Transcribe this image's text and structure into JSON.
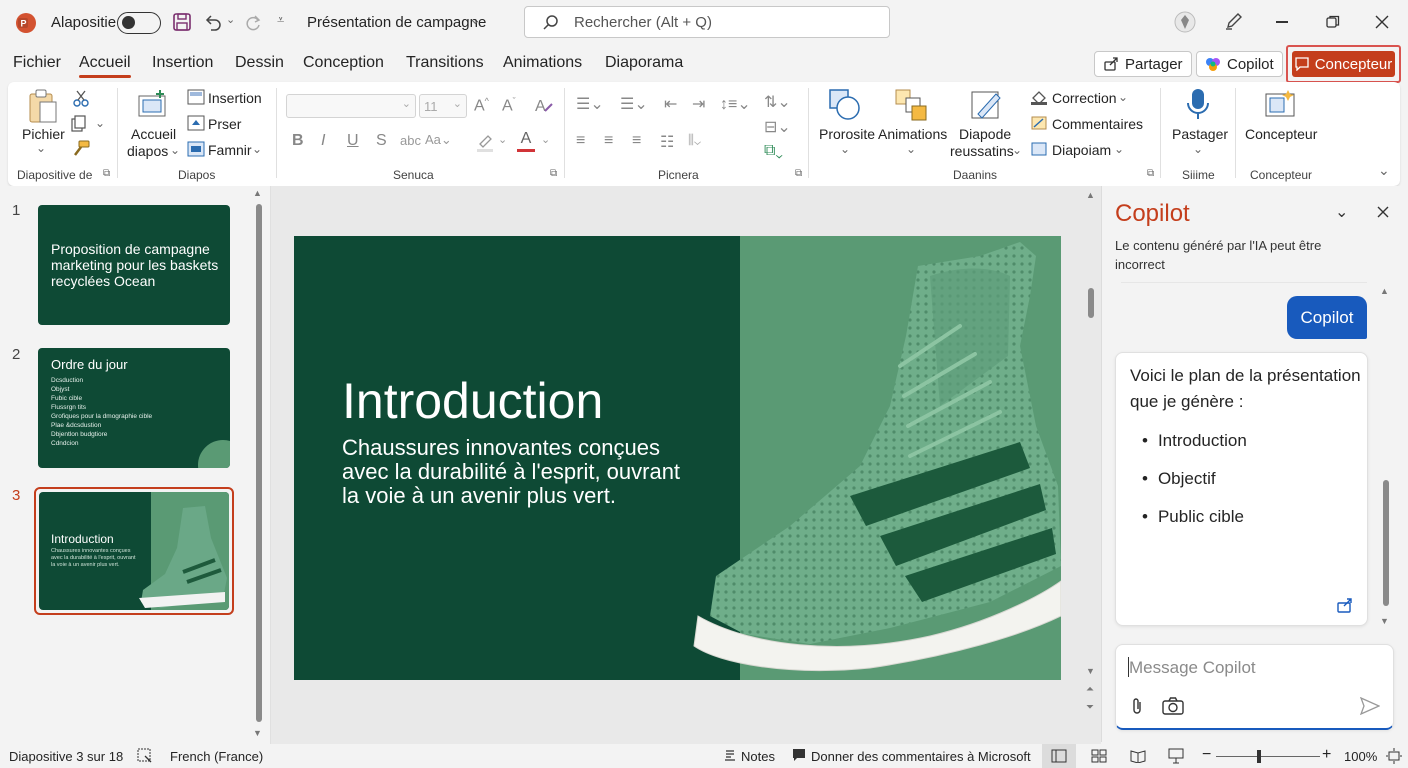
{
  "titlebar": {
    "app_icon": "powerpoint-icon",
    "autosave_label": "Alapositie",
    "doc_title": "Présentation de campagne",
    "search_placeholder": "Rechercher (Alt + Q)"
  },
  "menu": {
    "tabs": [
      "Fichier",
      "Accueil",
      "Insertion",
      "Dessin",
      "Conception",
      "Transitions",
      "Animations",
      "Diaporama"
    ],
    "share_label": "Partager",
    "copilot_label": "Copilot",
    "designer_label": "Concepteur"
  },
  "ribbon": {
    "paste_label": "Pichier",
    "new_slide_label_1": "Accueil",
    "new_slide_label_2": "diapos",
    "insertion_label": "Insertion",
    "prser_label": "Prser",
    "famnir_label": "Famnir",
    "font_size": "11",
    "correction_label": "Correction",
    "comments_label": "Commentaires",
    "diapoiam_label": "Diapoiam",
    "prorosite_label": "Prorosite",
    "animations_label": "Animations",
    "diapode_label_1": "Diapode",
    "diapode_label_2": "reussatins",
    "dictate_label": "Pastager",
    "designer_label": "Concepteur",
    "groups": {
      "clipboard": "Diapositive de",
      "slides": "Diapos",
      "font": "Senuca",
      "paragraph": "Picnera",
      "drawing": "Daanins",
      "voice": "Siiime",
      "designer": "Concepteur"
    },
    "bold": "B",
    "italic": "I",
    "underline": "U",
    "strike": "S",
    "font_color_letter": "A",
    "accent_color": "#c43e1c",
    "font_color": "#d13438"
  },
  "slides_panel": {
    "items": [
      {
        "num": "1",
        "title": "Proposition de campagne marketing pour les baskets recyclées Ocean"
      },
      {
        "num": "2",
        "title": "Ordre du jour",
        "bullets": [
          "Dcsduction",
          "Objyst",
          "Fubic cible",
          "Flussrgn tits",
          "Grofiques pour la dmographie cible",
          "Plae &dcsdustion",
          "Dbjentlon budgtiore",
          "Cdndcion"
        ]
      },
      {
        "num": "3",
        "title": "Introduction",
        "sub": "Chaussures innovantes conçues avec la durabilité à l'esprit, ouvrant la voie à un avenir plus vert."
      }
    ]
  },
  "slide": {
    "title": "Introduction",
    "subtitle": "Chaussures innovantes conçues avec la durabilité à l'esprit, ouvrant la voie à un avenir plus vert.",
    "bg_color": "#0e4a35",
    "accent_bg": "#5a9a74",
    "shoe_image": "green-knit-sneaker"
  },
  "copilot": {
    "title": "Copilot",
    "disclaimer": "Le contenu généré par l'IA peut être incorrect",
    "user_message": "Copilot",
    "response_intro": "Voici le plan de la présentation que je génère :",
    "response_items": [
      "Introduction",
      "Objectif",
      "Public cible"
    ],
    "input_placeholder": "Message Copilot",
    "user_bubble_color": "#185abd"
  },
  "status": {
    "slide_counter": "Diapositive 3 sur 18",
    "language": "French (France)",
    "notes_label": "Notes",
    "feedback_label": "Donner des commentaires à Microsoft",
    "zoom": "100%"
  }
}
